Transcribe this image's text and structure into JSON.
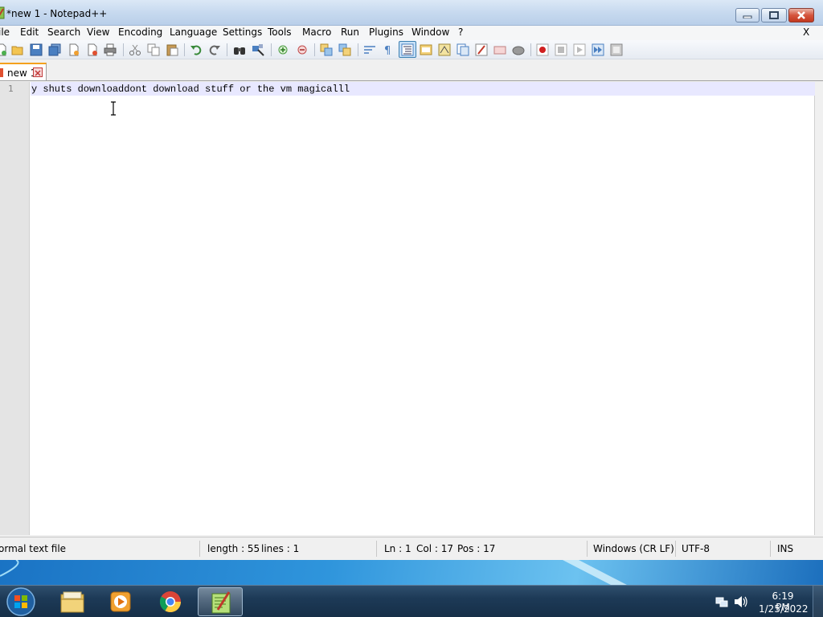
{
  "window": {
    "title": "*new 1 - Notepad++"
  },
  "menu": {
    "items": [
      "ile",
      "Edit",
      "Search",
      "View",
      "Encoding",
      "Language",
      "Settings",
      "Tools",
      "Macro",
      "Run",
      "Plugins",
      "Window",
      "?"
    ],
    "close_glyph": "X"
  },
  "toolbar": {
    "icons": [
      "new-file-icon",
      "open-file-icon",
      "save-icon",
      "save-all-icon",
      "close-icon",
      "close-all-icon",
      "print-icon",
      "cut-icon",
      "copy-icon",
      "paste-icon",
      "undo-icon",
      "redo-icon",
      "find-icon",
      "replace-icon",
      "zoom-in-icon",
      "zoom-out-icon",
      "sync-vertical-icon",
      "sync-horizontal-icon",
      "word-wrap-icon",
      "show-all-chars-icon",
      "indent-guide-icon",
      "language-icon",
      "doc-map-icon",
      "function-list-icon",
      "folder-workspace-icon",
      "monitoring-icon",
      "record-macro-icon",
      "stop-macro-icon",
      "play-macro-icon",
      "run-macro-multiple-icon",
      "save-macro-icon"
    ]
  },
  "tabs": [
    {
      "label": "new 1",
      "modified": true
    }
  ],
  "editor": {
    "line_number": "1",
    "text": "y shuts downloaddont download stuff or the vm magicalll"
  },
  "status": {
    "file_type": "ormal text file",
    "length": "length : 55",
    "lines": "lines : 1",
    "ln": "Ln : 1",
    "col": "Col : 17",
    "pos": "Pos : 17",
    "eol": "Windows (CR LF)",
    "encoding": "UTF-8",
    "mode": "INS"
  },
  "taskbar": {
    "apps": [
      "windows-explorer",
      "windows-media-player",
      "google-chrome",
      "notepad-plus-plus"
    ],
    "active_app": "notepad-plus-plus",
    "time": "6:19 PM",
    "date": "1/25/2022"
  },
  "colors": {
    "tab_accent": "#f4a11d",
    "current_line": "#e8e8ff",
    "taskbar": "#1d3a57"
  }
}
